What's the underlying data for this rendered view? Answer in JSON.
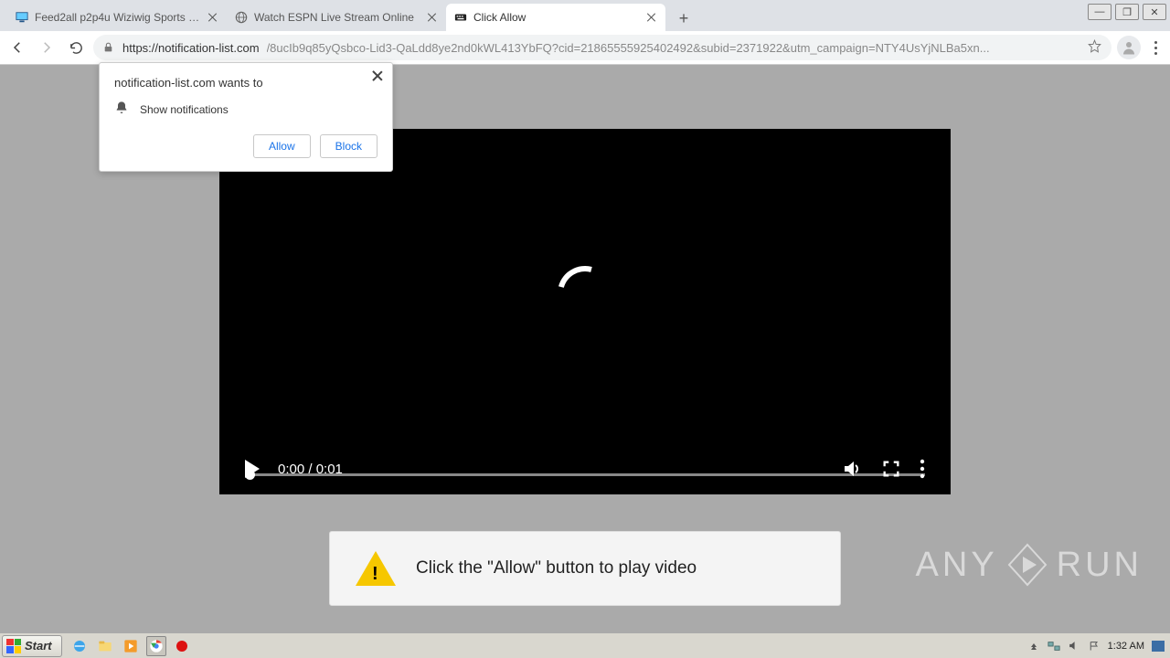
{
  "chrome": {
    "tabs": [
      {
        "title": "Feed2all p2p4u Wiziwig Sports Live F"
      },
      {
        "title": "Watch ESPN Live Stream Online"
      },
      {
        "title": "Click Allow"
      }
    ],
    "active_tab_index": 2,
    "url_host": "https://notification-list.com",
    "url_rest": "/8ucIb9q85yQsbco-Lid3-QaLdd8ye2nd0kWL413YbFQ?cid=21865555925402492&subid=2371922&utm_campaign=NTY4UsYjNLBa5xn..."
  },
  "permission": {
    "title": "notification-list.com wants to",
    "item": "Show notifications",
    "allow": "Allow",
    "block": "Block"
  },
  "video": {
    "time": "0:00 / 0:01"
  },
  "hint": {
    "text": "Click the \"Allow\" button to play video"
  },
  "watermark": {
    "left": "ANY",
    "right": "RUN"
  },
  "taskbar": {
    "start": "Start",
    "clock": "1:32 AM"
  }
}
